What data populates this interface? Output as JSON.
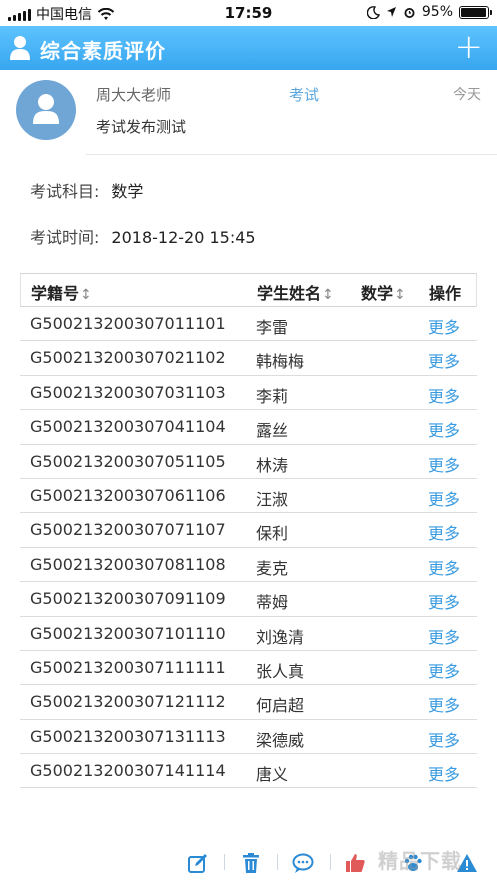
{
  "status_bar": {
    "carrier": "中国电信",
    "time": "17:59",
    "battery": "95%",
    "battery_level": 0.95
  },
  "header": {
    "title": "综合素质评价",
    "add_label": "+"
  },
  "message": {
    "sender": "周大大老师",
    "type": "考试",
    "date": "今天",
    "text": "考试发布测试"
  },
  "exam": {
    "subject_label": "考试科目:",
    "subject": "数学",
    "time_label": "考试时间:",
    "time": "2018-12-20 15:45"
  },
  "table": {
    "columns": [
      "学籍号",
      "学生姓名",
      "数学",
      "操作"
    ],
    "sort_icon": "↕",
    "rows": [
      {
        "id": "G500213200307011101",
        "name": "李雷",
        "score": "",
        "action": "更多"
      },
      {
        "id": "G500213200307021102",
        "name": "韩梅梅",
        "score": "",
        "action": "更多"
      },
      {
        "id": "G500213200307031103",
        "name": "李莉",
        "score": "",
        "action": "更多"
      },
      {
        "id": "G500213200307041104",
        "name": "露丝",
        "score": "",
        "action": "更多"
      },
      {
        "id": "G500213200307051105",
        "name": "林涛",
        "score": "",
        "action": "更多"
      },
      {
        "id": "G500213200307061106",
        "name": "汪淑",
        "score": "",
        "action": "更多"
      },
      {
        "id": "G500213200307071107",
        "name": "保利",
        "score": "",
        "action": "更多"
      },
      {
        "id": "G500213200307081108",
        "name": "麦克",
        "score": "",
        "action": "更多"
      },
      {
        "id": "G500213200307091109",
        "name": "蒂姆",
        "score": "",
        "action": "更多"
      },
      {
        "id": "G500213200307101110",
        "name": "刘逸清",
        "score": "",
        "action": "更多"
      },
      {
        "id": "G500213200307111111",
        "name": "张人真",
        "score": "",
        "action": "更多"
      },
      {
        "id": "G500213200307121112",
        "name": "何启超",
        "score": "",
        "action": "更多"
      },
      {
        "id": "G500213200307131113",
        "name": "梁德威",
        "score": "",
        "action": "更多"
      },
      {
        "id": "G500213200307141114",
        "name": "唐义",
        "score": "",
        "action": "更多"
      }
    ]
  },
  "toolbar": {
    "icons": [
      "edit-icon",
      "trash-icon",
      "comment-icon",
      "thumbs-up-icon",
      "paw-icon",
      "warning-icon"
    ]
  },
  "watermark": "精品下载",
  "colors": {
    "header": "#37a6ef",
    "link": "#3a9be0",
    "toolbar_icon": "#2a8ad4"
  }
}
